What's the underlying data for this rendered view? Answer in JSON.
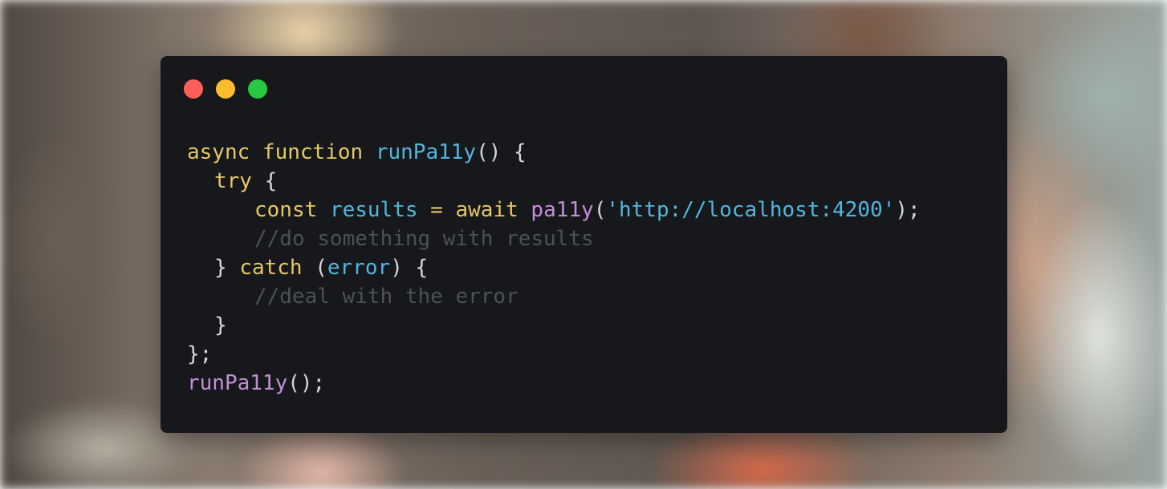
{
  "window": {
    "buttons": [
      {
        "name": "close",
        "color": "#ff5f57"
      },
      {
        "name": "minimize",
        "color": "#febc2e"
      },
      {
        "name": "maximize",
        "color": "#28c840"
      }
    ]
  },
  "code": {
    "line1": {
      "kw_async": "async",
      "kw_function": "function",
      "fn_name": "runPa11y",
      "rest": "() {"
    },
    "line2": {
      "kw_try": "try",
      "rest": " {"
    },
    "line3": {
      "kw_const": "const",
      "var": "results",
      "eq": " = ",
      "kw_await": "await",
      "call": "pa11y",
      "open": "(",
      "str": "'http://localhost:4200'",
      "close": ");"
    },
    "line4": {
      "comment": "//do something with results"
    },
    "line5": {
      "open": "} ",
      "kw_catch": "catch",
      "paren_open": " (",
      "var": "error",
      "rest": ") {"
    },
    "line6": {
      "comment": "//deal with the error"
    },
    "line7": {
      "text": "}"
    },
    "line8": {
      "text": "};"
    },
    "line9": {
      "call": "runPa11y",
      "rest": "();"
    }
  },
  "colors": {
    "editor_bg": "#17181b",
    "keyword": "#e6c765",
    "function": "#52b6e0",
    "call": "#c28fd6",
    "comment": "#4a5157",
    "text": "#d6d8dc"
  }
}
